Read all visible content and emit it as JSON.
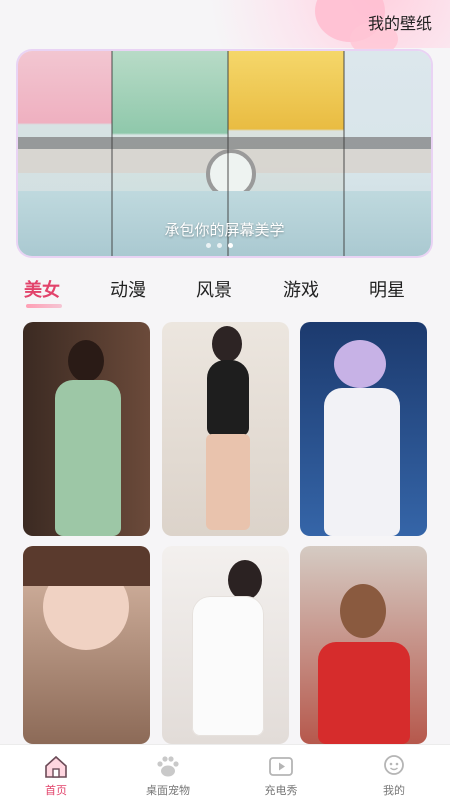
{
  "header": {
    "title": "我的壁纸"
  },
  "banner": {
    "caption": "承包你的屏幕美学",
    "slide_count": 3,
    "active_slide": 3
  },
  "categories": {
    "items": [
      "美女",
      "动漫",
      "风景",
      "游戏",
      "明星"
    ],
    "active_index": 0
  },
  "wallpapers": [
    {
      "kind": "woman-green-qipao"
    },
    {
      "kind": "woman-black-dress"
    },
    {
      "kind": "anime-cosplay-white"
    },
    {
      "kind": "woman-portrait-closeup"
    },
    {
      "kind": "woman-white-lying"
    },
    {
      "kind": "woman-red-sweater"
    }
  ],
  "bottom_nav": {
    "items": [
      {
        "label": "首页",
        "icon": "home-icon"
      },
      {
        "label": "桌面宠物",
        "icon": "paw-icon"
      },
      {
        "label": "充电秀",
        "icon": "video-play-icon"
      },
      {
        "label": "我的",
        "icon": "user-icon"
      }
    ],
    "active_index": 0
  },
  "colors": {
    "accent": "#e2436b",
    "background": "#f6f5f7"
  }
}
